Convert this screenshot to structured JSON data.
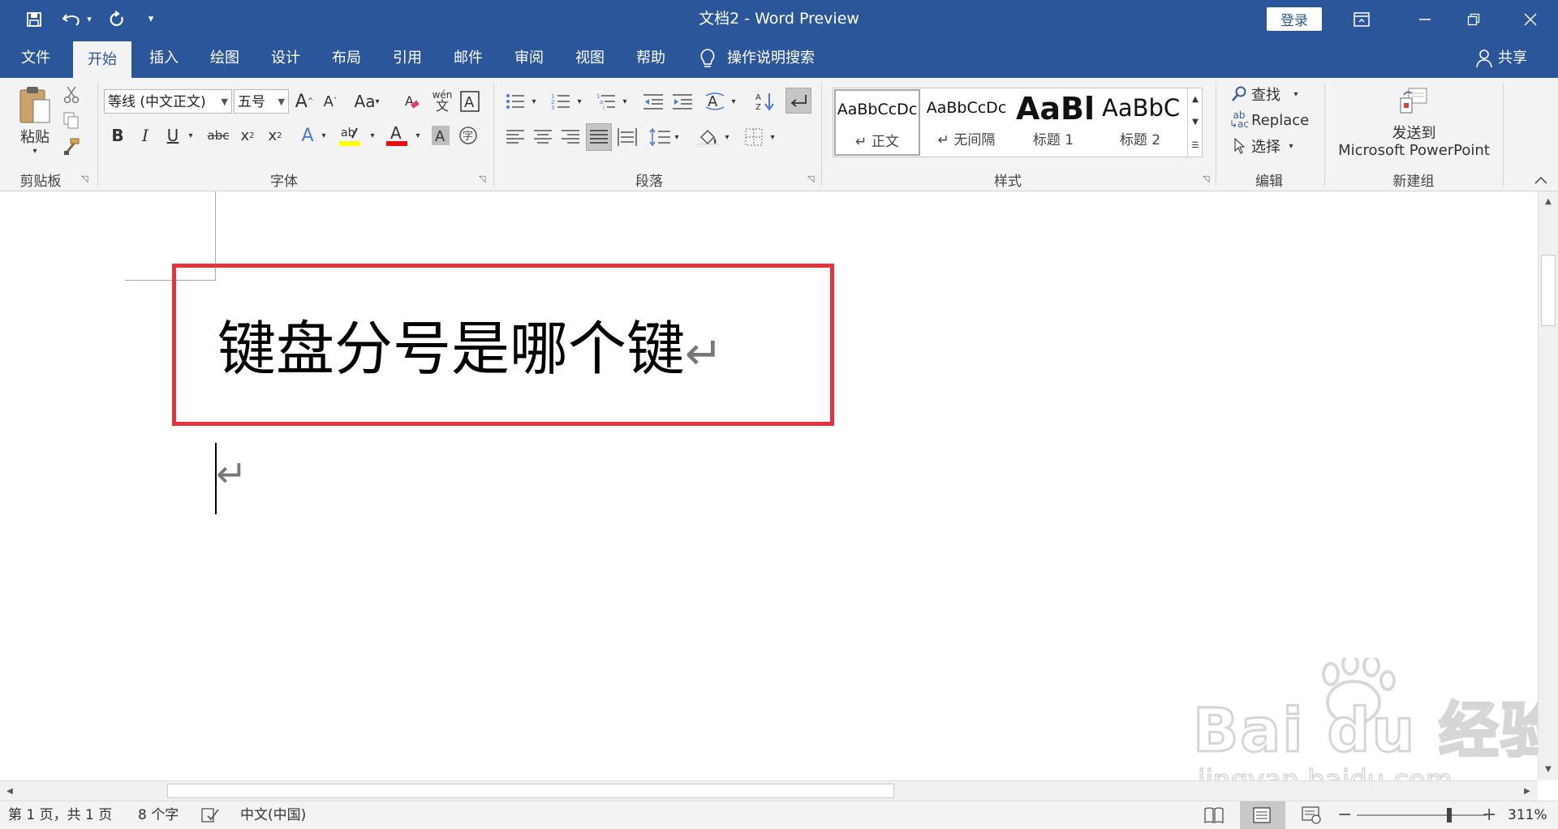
{
  "window": {
    "title": "文档2 - Word Preview",
    "login_label": "登录",
    "share_label": "共享"
  },
  "quick_access": {
    "save_icon": "save-icon",
    "undo_icon": "undo-icon",
    "redo_icon": "redo-icon",
    "customize_icon": "chevron-down-icon"
  },
  "tabs": [
    {
      "label": "文件"
    },
    {
      "label": "开始"
    },
    {
      "label": "插入"
    },
    {
      "label": "绘图"
    },
    {
      "label": "设计"
    },
    {
      "label": "布局"
    },
    {
      "label": "引用"
    },
    {
      "label": "邮件"
    },
    {
      "label": "审阅"
    },
    {
      "label": "视图"
    },
    {
      "label": "帮助"
    }
  ],
  "active_tab": "开始",
  "tell_me": "操作说明搜索",
  "ribbon": {
    "clipboard": {
      "paste_label": "粘贴",
      "group_label": "剪贴板"
    },
    "font": {
      "font_name": "等线 (中文正文)",
      "font_size": "五号",
      "change_case": "Aa",
      "group_label": "字体"
    },
    "paragraph": {
      "group_label": "段落"
    },
    "styles": {
      "group_label": "样式",
      "items": [
        {
          "sample": "AaBbCcDc",
          "name": "↵ 正文"
        },
        {
          "sample": "AaBbCcDc",
          "name": "↵ 无间隔"
        },
        {
          "sample": "AaBl",
          "name": "标题 1"
        },
        {
          "sample": "AaBbC",
          "name": "标题 2"
        }
      ]
    },
    "editing": {
      "find": "查找",
      "replace": "Replace",
      "select": "选择",
      "group_label": "编辑"
    },
    "newgroup": {
      "line1": "发送到",
      "line2": "Microsoft PowerPoint",
      "group_label": "新建组"
    }
  },
  "document": {
    "heading_text": "键盘分号是哪个键",
    "paragraph_mark": "↵",
    "highlight_color": "#e8323c"
  },
  "watermark": {
    "text": "Bai du 经验",
    "url": "jingyan.baidu.com"
  },
  "statusbar": {
    "page": "第 1 页，共 1 页",
    "words": "8 个字",
    "language": "中文(中国)",
    "zoom": "311%"
  },
  "colors": {
    "brand": "#2b579a",
    "ribbon_bg": "#f3f3f3"
  }
}
